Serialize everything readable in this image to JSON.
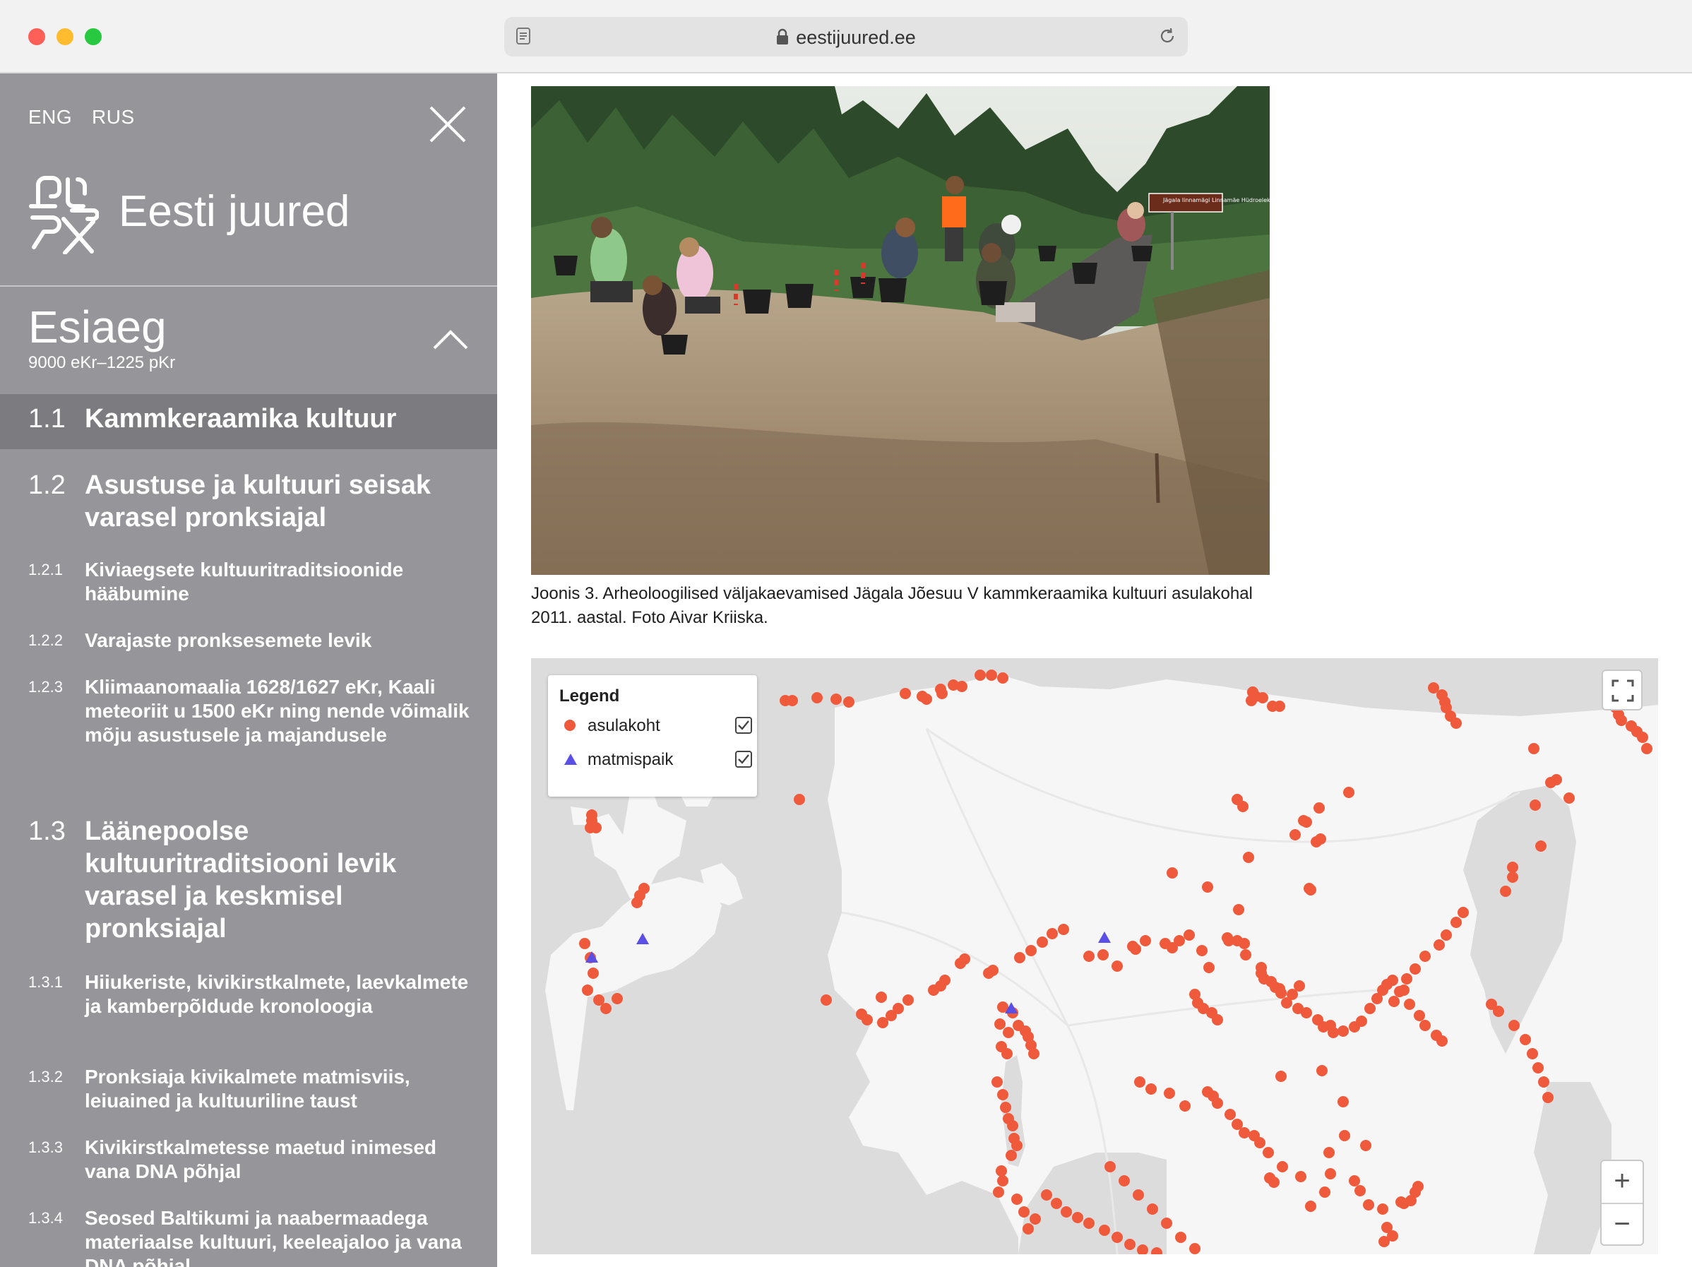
{
  "browser": {
    "url": "eestijuured.ee"
  },
  "sidebar": {
    "lang_eng": "ENG",
    "lang_rus": "RUS",
    "logo_text": "Eesti juured",
    "era_title": "Esiaeg",
    "era_range": "9000 eKr–1225 pKr",
    "items": [
      {
        "num": "1.1",
        "label": "Kammkeraamika kultuur",
        "level": 2,
        "active": true
      },
      {
        "num": "1.2",
        "label": "Asustuse ja kultuuri seisak varasel pronksiajal",
        "level": 2
      },
      {
        "num": "1.2.1",
        "label": "Kiviaegsete kultuuritraditsioonide hääbumine",
        "level": 3
      },
      {
        "num": "1.2.2",
        "label": "Varajaste pronksesemete levik",
        "level": 3
      },
      {
        "num": "1.2.3",
        "label": "Kliimaanomaalia 1628/1627 eKr, Kaali meteoriit u 1500 eKr ning nende võimalik mõju asustusele ja majandusele",
        "level": 3
      },
      {
        "num": "1.3",
        "label": "Läänepoolse kultuuritraditsiooni levik varasel ja keskmisel pronksiajal",
        "level": 2
      },
      {
        "num": "1.3.1",
        "label": "Hiiukeriste, kivikirstkalmete, laevkalmete ja kamberpõldude kronoloogia",
        "level": 3
      },
      {
        "num": "1.3.2",
        "label": "Pronksiaja kivikalmete matmisviis, leiuained ja kultuuriline taust",
        "level": 3
      },
      {
        "num": "1.3.3",
        "label": "Kivikirstkalmetesse maetud inimesed vana DNA põhjal",
        "level": 3
      },
      {
        "num": "1.3.4",
        "label": "Seosed Baltikumi ja naabermaadega materiaalse kultuuri, keeleajaloo ja vana DNA põhjal",
        "level": 3
      }
    ]
  },
  "figure": {
    "caption": "Joonis 3. Arheoloogilised väljakaevamised Jägala Jõesuu V kammkeraamika kultuuri asulakohal 2011. aastal. Foto Aivar Kriiska.",
    "sign_text": "Jägala linnamägi Linnamäe Hüdroelektrijaam"
  },
  "map": {
    "legend_title": "Legend",
    "layers": [
      {
        "label": "asulakoht",
        "symbol": "circle",
        "color": "#f05a3c",
        "checked": true
      },
      {
        "label": "matmispaik",
        "symbol": "triangle",
        "color": "#5a50e6",
        "checked": true
      }
    ],
    "zoom_in": "+",
    "zoom_out": "−",
    "colors": {
      "water": "#dcdcdc",
      "land": "#f6f6f6",
      "settlement": "#f05a3c",
      "burial": "#5a50e6"
    }
  }
}
